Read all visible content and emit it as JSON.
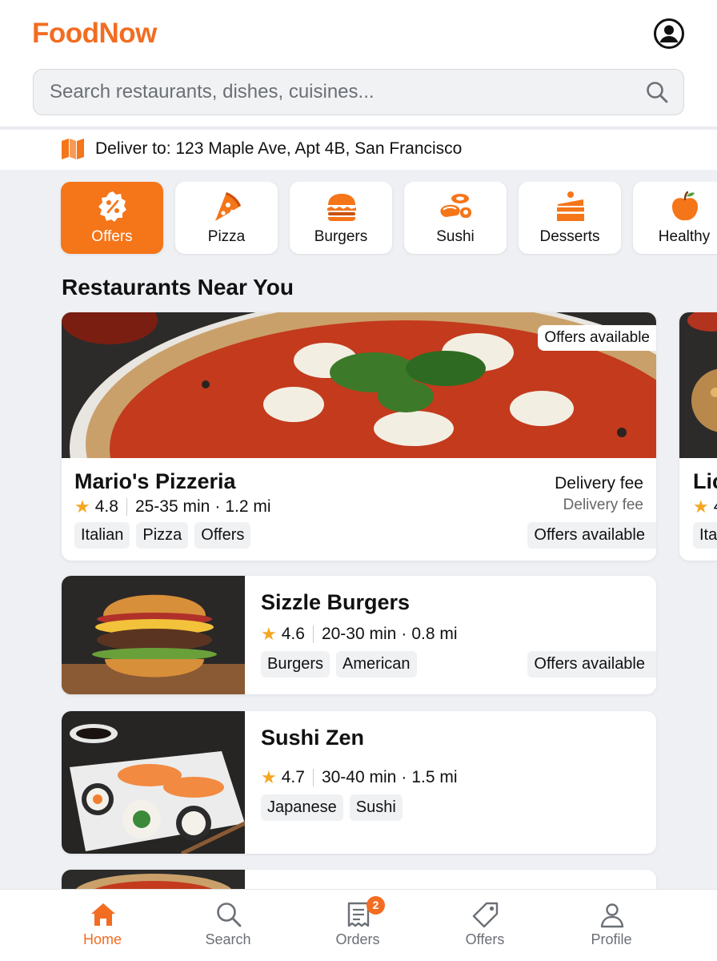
{
  "app": {
    "logo": "FoodNow",
    "profile_icon": "user-circle-icon"
  },
  "search": {
    "placeholder": "Search restaurants, dishes, cuisines...",
    "value": "",
    "icon": "search-icon"
  },
  "delivery": {
    "icon": "map-icon",
    "text": "Deliver to: 123 Maple Ave, Apt 4B, San Francisco"
  },
  "categories": [
    {
      "label": "Offers",
      "icon": "percent-badge-icon",
      "active": true
    },
    {
      "label": "Pizza",
      "icon": "pizza-slice-icon"
    },
    {
      "label": "Burgers",
      "icon": "burger-icon"
    },
    {
      "label": "Sushi",
      "icon": "sushi-icon"
    },
    {
      "label": "Desserts",
      "icon": "cake-icon"
    },
    {
      "label": "Healthy",
      "icon": "apple-icon"
    }
  ],
  "section_title": "Restaurants Near You",
  "featured": {
    "name": "Mario's Pizzeria",
    "offers_tag": "Offers available",
    "rating": "4.8",
    "time": "25-35 min",
    "distance": "1.2 mi",
    "fee_label": "Delivery fee",
    "fee_value": "Delivery fee",
    "tags": [
      "Italian",
      "Pizza",
      "Offers"
    ],
    "offers_chip": "Offers available"
  },
  "peek_card": {
    "name": "Lic",
    "rating": "4",
    "tag": "Ita"
  },
  "restaurants": [
    {
      "name": "Sizzle Burgers",
      "rating": "4.6",
      "time": "20-30 min",
      "distance": "0.8 mi",
      "tags": [
        "Burgers",
        "American"
      ],
      "offers_chip": "Offers available"
    },
    {
      "name": "Sushi Zen",
      "rating": "4.7",
      "time": "30-40 min",
      "distance": "1.5 mi",
      "tags": [
        "Japanese",
        "Sushi"
      ]
    }
  ],
  "separators": {
    "dot": "·"
  },
  "nav": [
    {
      "label": "Home",
      "icon": "home-icon",
      "active": true
    },
    {
      "label": "Search",
      "icon": "search-icon"
    },
    {
      "label": "Orders",
      "icon": "receipt-icon",
      "badge": "2"
    },
    {
      "label": "Offers",
      "icon": "tag-icon"
    },
    {
      "label": "Profile",
      "icon": "user-icon"
    }
  ],
  "colors": {
    "brand": "#f26d21",
    "active_category": "#f57519",
    "star": "#f5a623"
  }
}
